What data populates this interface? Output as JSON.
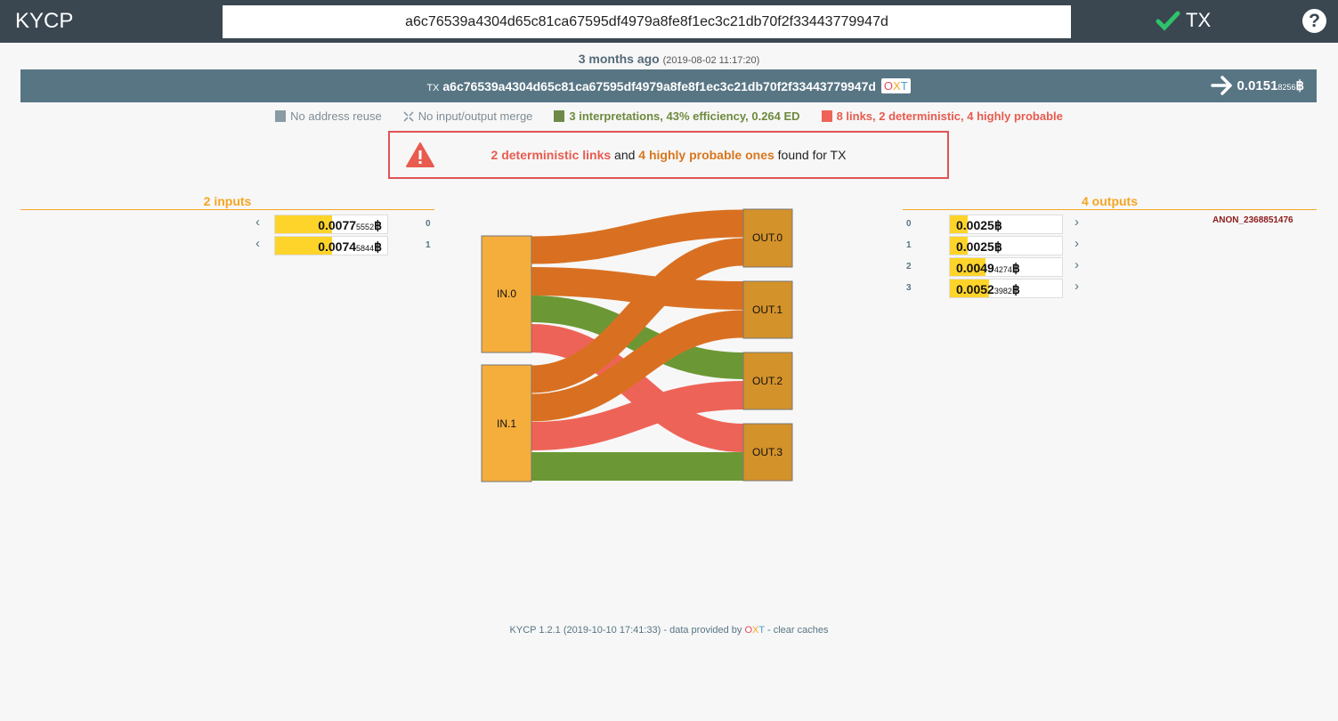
{
  "app": {
    "title": "KYCP",
    "mode_label": "TX",
    "help_label": "?"
  },
  "search": {
    "value": "a6c76539a4304d65c81ca67595df4979a8fe8f1ec3c21db70f2f33443779947d"
  },
  "tx": {
    "age": "3 months ago",
    "timestamp": "(2019-08-02 11:17:20)",
    "label": "TX",
    "id": "a6c76539a4304d65c81ca67595df4979a8fe8f1ec3c21db70f2f33443779947d",
    "oxt_o": "O",
    "oxt_x": "X",
    "oxt_t": "T",
    "amount_main": "0.0151",
    "amount_small": "8256",
    "currency": "฿"
  },
  "legend": {
    "address_reuse": "No address reuse",
    "merge": "No input/output merge",
    "interpretations": "3 interpretations, 43% efficiency, 0.264 ED",
    "links": "8 links, 2 deterministic, 4 highly probable"
  },
  "alert": {
    "deterministic": "2 deterministic links",
    "and": " and ",
    "probable": "4 highly probable ones",
    "suffix": " found for TX"
  },
  "inputs": {
    "title": "2 inputs",
    "items": [
      {
        "index": "0",
        "main": "0.0077",
        "small": "5552",
        "fill": 0.5
      },
      {
        "index": "1",
        "main": "0.0074",
        "small": "5844",
        "fill": 0.5
      }
    ]
  },
  "outputs": {
    "title": "4 outputs",
    "anon_label": "ANON_2368851476",
    "items": [
      {
        "index": "0",
        "main": "0.0025",
        "small": "",
        "fill": 0.17
      },
      {
        "index": "1",
        "main": "0.0025",
        "small": "",
        "fill": 0.17
      },
      {
        "index": "2",
        "main": "0.0049",
        "small": "4274",
        "fill": 0.33
      },
      {
        "index": "3",
        "main": "0.0052",
        "small": "3982",
        "fill": 0.35
      }
    ]
  },
  "diagram": {
    "nodes": {
      "in0": "IN.0",
      "in1": "IN.1",
      "out0": "OUT.0",
      "out1": "OUT.1",
      "out2": "OUT.2",
      "out3": "OUT.3"
    },
    "colors": {
      "deterministic": "#ee6357",
      "probable": "#d97021",
      "possible": "#6b9834",
      "in_node": "#f5ad3c",
      "out_node": "#d4922a"
    }
  },
  "footer": {
    "version": "KYCP 1.2.1 (2019-10-10 17:41:33) - data provided by ",
    "oxt_o": "O",
    "oxt_x": "X",
    "oxt_t": "T",
    "sep": " - ",
    "clear": "clear caches"
  }
}
